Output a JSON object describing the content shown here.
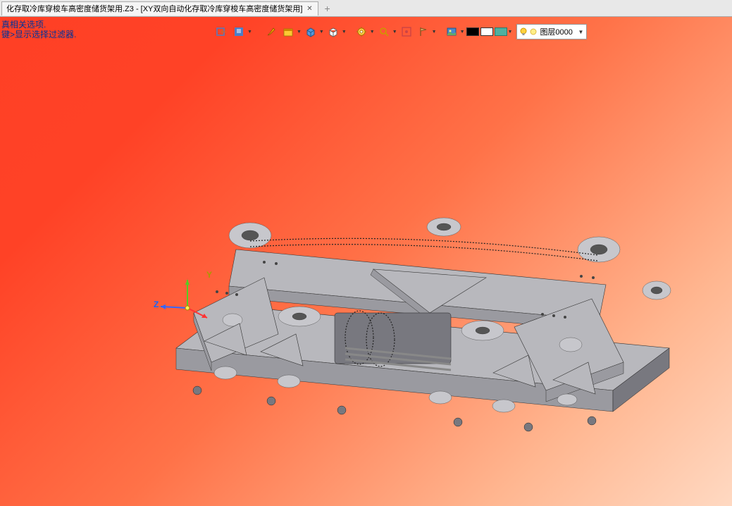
{
  "tabs": {
    "active_label": "化存取冷库穿梭车高密度储货架用.Z3 - [XY双向自动化存取冷库穿梭车高密度储货架用]"
  },
  "prompts": {
    "line1": "真相关选项.",
    "line2": "键>显示选择过滤器."
  },
  "icons": {
    "close": "✕",
    "plus": "+"
  },
  "triad": {
    "y_label": "Y",
    "z_label": "Z"
  },
  "layer": {
    "name": "图层0000"
  },
  "toolbar": {
    "tool1": "visibility",
    "tool2": "view-style",
    "tool3": "paint-brush",
    "tool4": "render-shade",
    "tool5": "box-mode",
    "tool6": "cube-wire",
    "tool7": "gear",
    "tool8": "search",
    "tool9": "rect",
    "tool10": "flag",
    "tool11": "image",
    "swatch_black": "#000000",
    "swatch_white": "#ffffff",
    "swatch_teal": "#4fb09f",
    "bulb_yellow": "#ffd23f",
    "bulb_light": "#ffee88"
  }
}
